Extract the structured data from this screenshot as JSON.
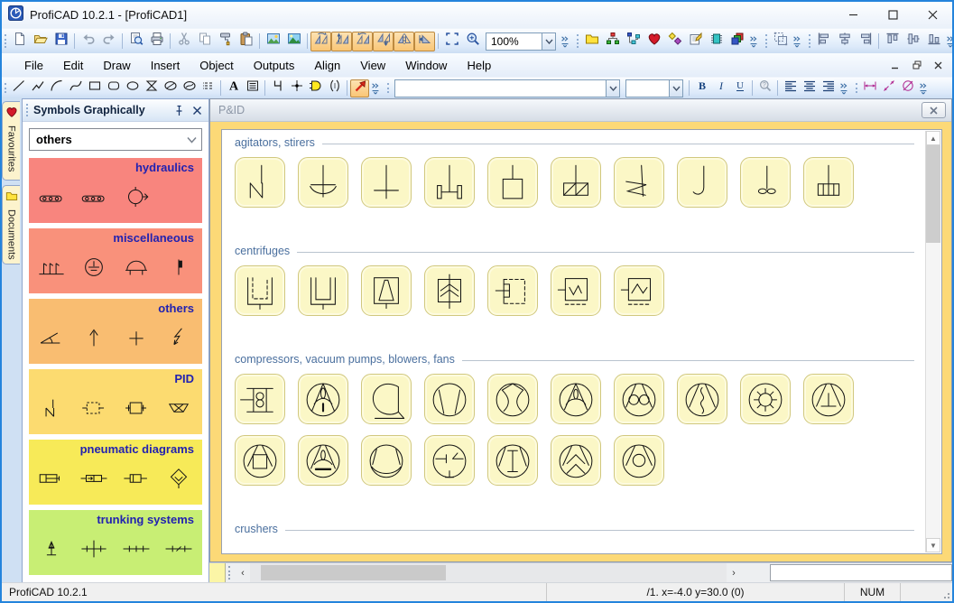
{
  "window": {
    "title": "ProfiCAD 10.2.1 - [ProfiCAD1]",
    "controls": [
      "minimize",
      "maximize",
      "close"
    ]
  },
  "menu_bar": {
    "items": [
      "File",
      "Edit",
      "Draw",
      "Insert",
      "Object",
      "Outputs",
      "Align",
      "View",
      "Window",
      "Help"
    ],
    "mdi_controls": [
      "minimize",
      "restore",
      "close"
    ]
  },
  "toolbar_standard": {
    "groups": [
      [
        {
          "icon": "new-document"
        },
        {
          "icon": "open-folder"
        },
        {
          "icon": "save"
        },
        {
          "sep": true
        },
        {
          "icon": "undo",
          "state": "disabled"
        },
        {
          "icon": "redo",
          "state": "disabled"
        },
        {
          "sep": true
        },
        {
          "icon": "print-preview"
        },
        {
          "icon": "print"
        },
        {
          "sep": true
        },
        {
          "icon": "cut",
          "state": "disabled"
        },
        {
          "icon": "copy",
          "state": "disabled"
        },
        {
          "icon": "format-painter"
        },
        {
          "icon": "paste"
        },
        {
          "sep": true
        },
        {
          "icon": "insert-image"
        },
        {
          "icon": "insert-image-alt"
        },
        {
          "sep": true
        },
        {
          "icon": "rotate-left",
          "state": "active"
        },
        {
          "icon": "flip-vertical",
          "state": "active"
        },
        {
          "icon": "rotate-right",
          "state": "active"
        },
        {
          "icon": "flip-down",
          "state": "active"
        },
        {
          "icon": "mirror-horizontal",
          "state": "active"
        },
        {
          "icon": "mirror-left",
          "state": "active"
        },
        {
          "sep": true
        },
        {
          "icon": "select-area"
        },
        {
          "icon": "zoom-in"
        },
        {
          "combo": "100%",
          "name": "zoom-combo"
        },
        {
          "chevron": true
        }
      ],
      [
        {
          "icon": "symbols-folder"
        },
        {
          "icon": "symbols-tree-red"
        },
        {
          "icon": "symbols-tree-blue"
        },
        {
          "icon": "favourites-heart"
        },
        {
          "icon": "symbols-palette"
        },
        {
          "icon": "edit-symbol"
        },
        {
          "icon": "integrated-circuit"
        },
        {
          "icon": "layers"
        },
        {
          "chevron": true
        }
      ],
      [
        {
          "icon": "group-objects"
        },
        {
          "chevron": true
        }
      ],
      [
        {
          "icon": "align-left"
        },
        {
          "icon": "align-center"
        },
        {
          "icon": "align-right"
        },
        {
          "sep": true
        },
        {
          "icon": "align-top"
        },
        {
          "icon": "align-middle"
        },
        {
          "icon": "align-bottom"
        },
        {
          "chevron": true
        }
      ]
    ],
    "zoom_value": "100%"
  },
  "toolbar_drawing": {
    "groups": [
      [
        {
          "icon": "line"
        },
        {
          "icon": "polyline"
        },
        {
          "icon": "arc"
        },
        {
          "icon": "bezier-curve"
        },
        {
          "icon": "rectangle"
        },
        {
          "icon": "rounded-rectangle"
        },
        {
          "icon": "ellipse"
        },
        {
          "icon": "hourglass"
        },
        {
          "icon": "crossed-ellipse"
        },
        {
          "icon": "curved-ellipse"
        },
        {
          "icon": "hatch-lines"
        },
        {
          "sep": true
        },
        {
          "icon": "text"
        },
        {
          "icon": "text-block"
        },
        {
          "sep": true
        },
        {
          "icon": "gate-outline"
        },
        {
          "icon": "connection-point"
        },
        {
          "icon": "and-gate"
        },
        {
          "icon": "connector-brace"
        },
        {
          "sep": true
        },
        {
          "icon": "select-arrow",
          "state": "active"
        },
        {
          "chevron": true
        }
      ],
      [
        {
          "combo": "",
          "name": "font-family-combo"
        },
        {
          "combo": "",
          "name": "font-size-combo"
        },
        {
          "sep": true
        },
        {
          "icon": "bold"
        },
        {
          "icon": "italic"
        },
        {
          "icon": "underline"
        },
        {
          "sep": true
        },
        {
          "icon": "signs",
          "state": "disabled"
        },
        {
          "sep": true
        },
        {
          "icon": "text-align-left"
        },
        {
          "icon": "text-align-center"
        },
        {
          "icon": "text-align-right"
        },
        {
          "chevron": true
        }
      ],
      [
        {
          "icon": "dimension-horizontal"
        },
        {
          "icon": "dimension-angled"
        },
        {
          "icon": "dimension-diameter"
        },
        {
          "chevron": true
        }
      ]
    ],
    "font_family_value": "",
    "font_size_value": ""
  },
  "left_dock_tabs": [
    {
      "label": "Favourites",
      "icon": "heart-icon"
    },
    {
      "label": "Documents",
      "icon": "folder-icon"
    }
  ],
  "symbols_panel": {
    "title": "Symbols Graphically",
    "dropdown_value": "others",
    "label_color": "#2222b0",
    "categories": [
      {
        "label": "hydraulics",
        "color": "#f8857e",
        "symbols": [
          "hydraulic-track",
          "hydraulic-track",
          "hydraulic-pump"
        ]
      },
      {
        "label": "miscellaneous",
        "color": "#f9917b",
        "symbols": [
          "misc-posts",
          "misc-earth",
          "misc-dome",
          "misc-flag"
        ]
      },
      {
        "label": "others",
        "color": "#f9bd71",
        "symbols": [
          "oth-angle",
          "oth-arrow-up",
          "oth-cross",
          "oth-lightning"
        ]
      },
      {
        "label": "PID",
        "color": "#fcdb70",
        "symbols": [
          "pid-agitator",
          "pid-dashed-box",
          "pid-box-ports",
          "pid-trapezoid"
        ]
      },
      {
        "label": "pneumatic diagrams",
        "color": "#f7ea58",
        "symbols": [
          "pne-cylinder",
          "pne-valve",
          "pne-box",
          "pne-diamond"
        ]
      },
      {
        "label": "trunking systems",
        "color": "#c8ee74",
        "symbols": [
          "trk-pole",
          "trk-cross",
          "trk-segments",
          "trk-segments-slash"
        ]
      }
    ]
  },
  "document": {
    "title": "P&ID",
    "groups": [
      {
        "label": "agitators, stirers",
        "symbols": [
          "agitator-blade",
          "agitator-anchor",
          "agitator-crossbar",
          "agitator-paddle",
          "agitator-square",
          "agitator-hatched-box",
          "agitator-zigzag",
          "agitator-hook",
          "agitator-propeller",
          "agitator-divided-box"
        ]
      },
      {
        "label": "centrifuges",
        "symbols": [
          "centrifuge-dashed-basket",
          "centrifuge-basket",
          "centrifuge-cone",
          "centrifuge-chevrons",
          "centrifuge-side-inlet",
          "centrifuge-zigzag",
          "centrifuge-zigzag-dashed"
        ]
      },
      {
        "label": "compressors, vacuum pumps, blowers, fans",
        "symbols": [
          "fan-figure-eight",
          "fan-propeller",
          "fan-volute",
          "compressor-trapezoid",
          "compressor-curved-vanes",
          "compressor-three-blade",
          "roots-blower",
          "compressor-wavy",
          "compressor-sun-rotor",
          "compressor-t-support",
          "compressor-square-rotor",
          "compressor-propeller-bar",
          "compressor-dome",
          "compressor-nozzles",
          "compressor-i-beam",
          "compressor-double-chevron",
          "compressor-ring"
        ]
      },
      {
        "label": "crushers",
        "symbols": [],
        "clipped": true
      }
    ]
  },
  "status_bar": {
    "app_version": "ProfiCAD 10.2.1",
    "position_info": "/1.  x=-4.0  y=30.0 (0)",
    "num_lock": "NUM"
  }
}
